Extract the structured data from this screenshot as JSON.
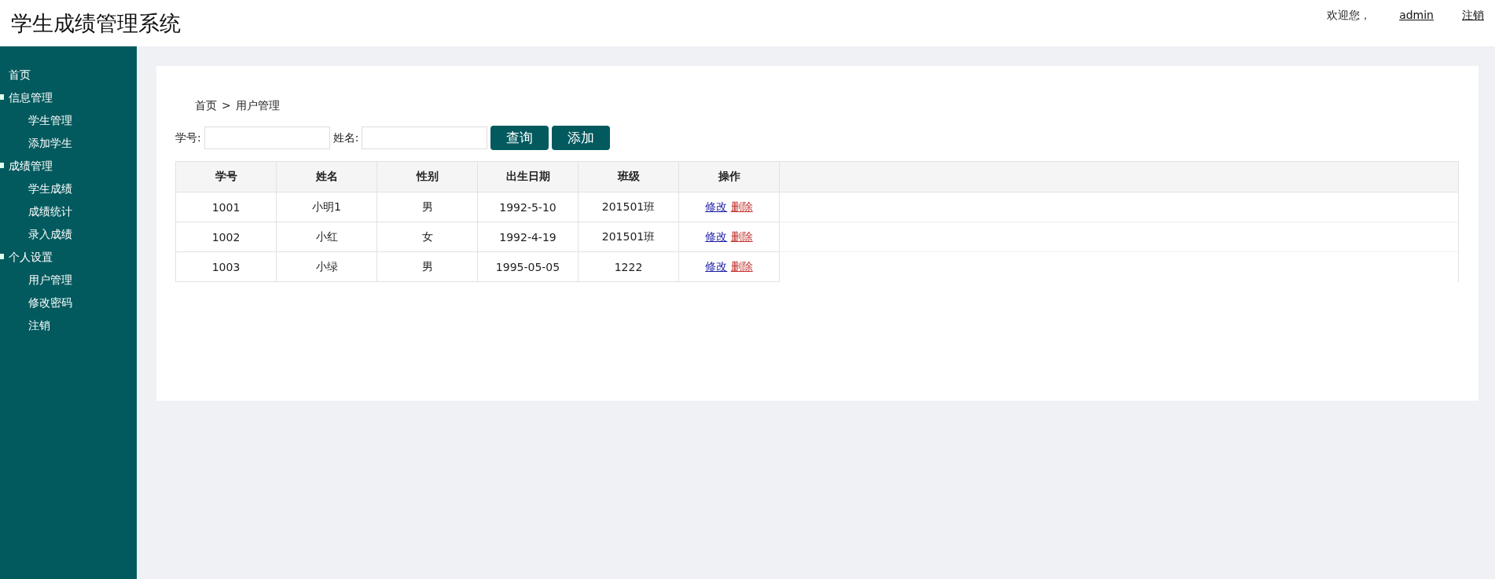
{
  "header": {
    "title": "学生成绩管理系统",
    "welcome": "欢迎您，",
    "user": "admin",
    "logout": "注销"
  },
  "sidebar": {
    "items": [
      {
        "label": "首页",
        "kind": "link"
      },
      {
        "label": "信息管理",
        "kind": "group",
        "expanded": true,
        "children": [
          {
            "label": "学生管理"
          },
          {
            "label": "添加学生"
          }
        ]
      },
      {
        "label": "成绩管理",
        "kind": "group",
        "expanded": true,
        "children": [
          {
            "label": "学生成绩"
          },
          {
            "label": "成绩统计"
          },
          {
            "label": "录入成绩"
          }
        ]
      },
      {
        "label": "个人设置",
        "kind": "group",
        "expanded": true,
        "children": [
          {
            "label": "用户管理"
          },
          {
            "label": "修改密码"
          },
          {
            "label": "注销"
          }
        ]
      }
    ]
  },
  "breadcrumb": [
    "首页",
    ">",
    "用户管理"
  ],
  "search": {
    "fields": [
      {
        "label": "学号:"
      },
      {
        "label": "姓名:"
      }
    ],
    "buttons": [
      "查询",
      "添加"
    ]
  },
  "table": {
    "columns": [
      "学号",
      "姓名",
      "性别",
      "出生日期",
      "班级",
      "操作"
    ],
    "rows": [
      {
        "cells": [
          "1001",
          "小明1",
          "男",
          "1992-5-10",
          "201501班"
        ],
        "actions": [
          "修改",
          "删除"
        ]
      },
      {
        "cells": [
          "1002",
          "小红",
          "女",
          "1992-4-19",
          "201501班"
        ],
        "actions": [
          "修改",
          "删除"
        ]
      },
      {
        "cells": [
          "1003",
          "小绿",
          "男",
          "1995-05-05",
          "1222"
        ],
        "actions": [
          "修改",
          "删除"
        ]
      }
    ]
  }
}
